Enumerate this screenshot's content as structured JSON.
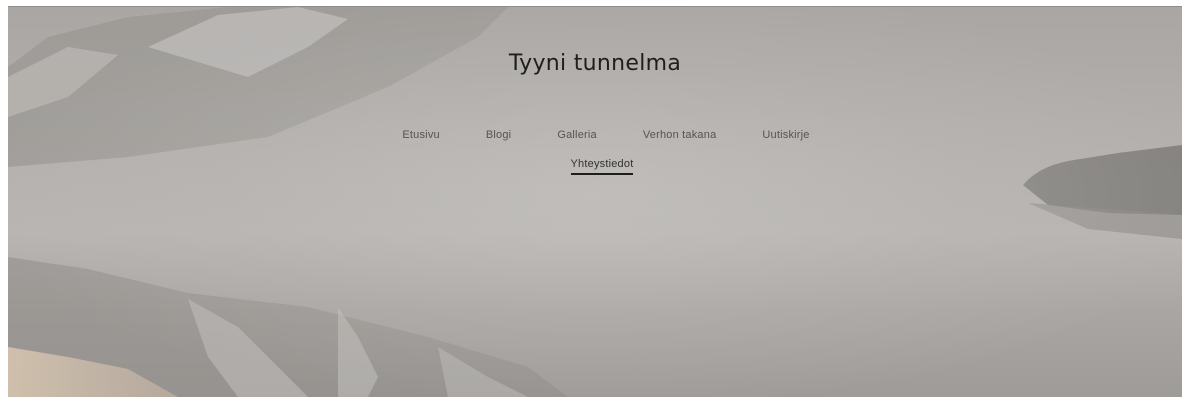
{
  "site": {
    "title": "Tyyni tunnelma"
  },
  "nav": {
    "items": [
      {
        "label": "Etusivu"
      },
      {
        "label": "Blogi"
      },
      {
        "label": "Galleria"
      },
      {
        "label": "Verhon takana"
      },
      {
        "label": "Uutiskirje"
      }
    ],
    "current": {
      "label": "Yhteystiedot"
    }
  },
  "colors": {
    "title_text": "#1e1e1e",
    "nav_text": "#555452",
    "active_underline": "#1e1e1e"
  }
}
